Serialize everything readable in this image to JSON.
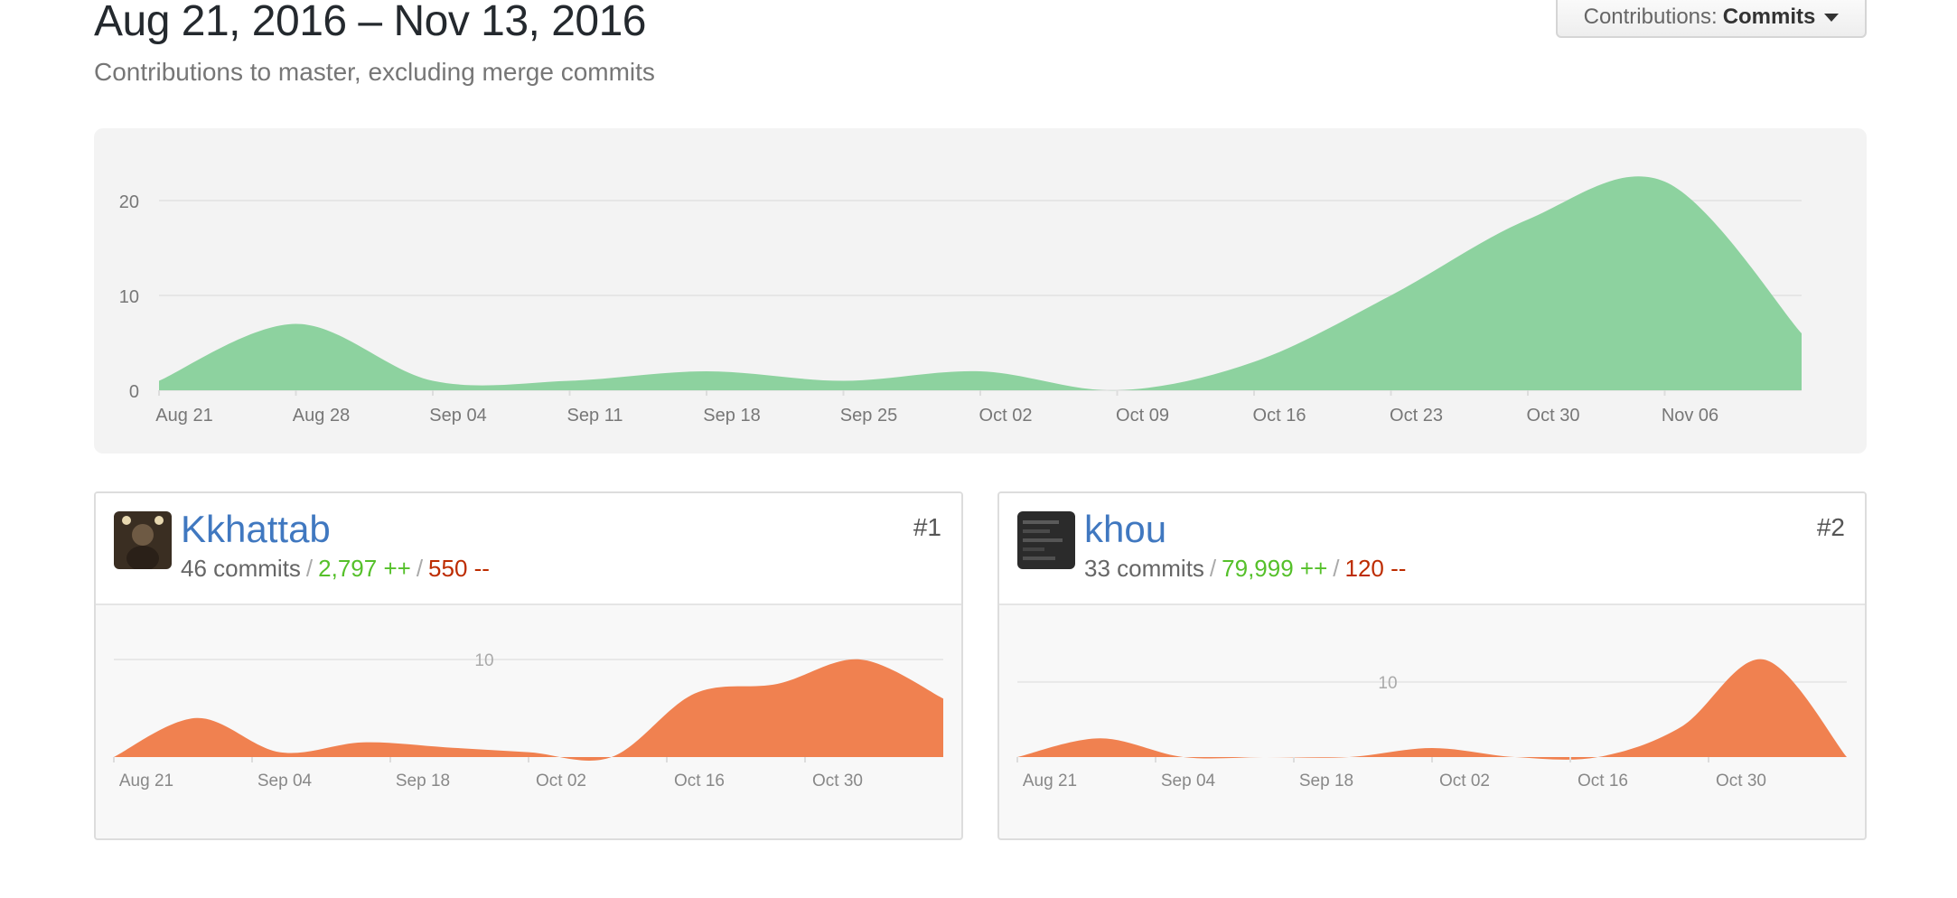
{
  "header": {
    "title": "Aug 21, 2016 – Nov 13, 2016",
    "subtitle": "Contributions to master, excluding merge commits",
    "contributions_label": "Contributions:",
    "contributions_value": "Commits"
  },
  "colors": {
    "main_area": "#8dd29f",
    "contributor_area": "#f08150",
    "link": "#4078c0",
    "additions": "#55c02a",
    "deletions": "#bd2c00"
  },
  "icons": {
    "dropdown": "caret-down-icon"
  },
  "contributors": [
    {
      "name": "Kkhattab",
      "rank": "#1",
      "commits": "46 commits",
      "additions": "2,797 ++",
      "deletions": "550 --",
      "avatar": "avatar-photo"
    },
    {
      "name": "khou",
      "rank": "#2",
      "commits": "33 commits",
      "additions": "79,999 ++",
      "deletions": "120 --",
      "avatar": "avatar-photo"
    }
  ],
  "chart_data": [
    {
      "type": "area",
      "x": [
        "Aug 21",
        "Aug 28",
        "Sep 04",
        "Sep 11",
        "Sep 18",
        "Sep 25",
        "Oct 02",
        "Oct 09",
        "Oct 16",
        "Oct 23",
        "Oct 30",
        "Nov 06",
        "Nov 13"
      ],
      "values": [
        1,
        7,
        1,
        1,
        2,
        1,
        2,
        0,
        3,
        10,
        18,
        22,
        6
      ],
      "yticks": [
        0,
        10,
        20
      ],
      "ylim": [
        0,
        24
      ],
      "xlabels": [
        "Aug 21",
        "Aug 28",
        "Sep 04",
        "Sep 11",
        "Sep 18",
        "Sep 25",
        "Oct 02",
        "Oct 09",
        "Oct 16",
        "Oct 23",
        "Oct 30",
        "Nov 06"
      ],
      "grid": true
    },
    {
      "type": "area",
      "series": [
        {
          "name": "Kkhattab",
          "values": [
            0,
            4,
            0.5,
            1.5,
            1,
            0.5,
            0,
            6.5,
            7.5,
            10,
            6
          ]
        }
      ],
      "x": [
        "Aug 21",
        "Aug 28",
        "Sep 04",
        "Sep 11",
        "Sep 18",
        "Sep 25",
        "Oct 02",
        "Oct 16",
        "Oct 23",
        "Oct 30",
        "Nov 13"
      ],
      "xlabels": [
        "Aug 21",
        "Sep 04",
        "Sep 18",
        "Oct 02",
        "Oct 16",
        "Oct 30"
      ],
      "yticks": [
        10
      ],
      "ylim": [
        0,
        10
      ]
    },
    {
      "type": "area",
      "series": [
        {
          "name": "khou",
          "values": [
            0,
            2.5,
            0,
            0,
            0,
            1.2,
            0,
            0,
            4,
            13,
            0
          ]
        }
      ],
      "x": [
        "Aug 21",
        "Aug 28",
        "Sep 04",
        "Sep 11",
        "Sep 18",
        "Sep 25",
        "Oct 02",
        "Oct 16",
        "Oct 23",
        "Oct 30",
        "Nov 13"
      ],
      "xlabels": [
        "Aug 21",
        "Sep 04",
        "Sep 18",
        "Oct 02",
        "Oct 16",
        "Oct 30"
      ],
      "yticks": [
        10
      ],
      "ylim": [
        0,
        13
      ]
    }
  ]
}
